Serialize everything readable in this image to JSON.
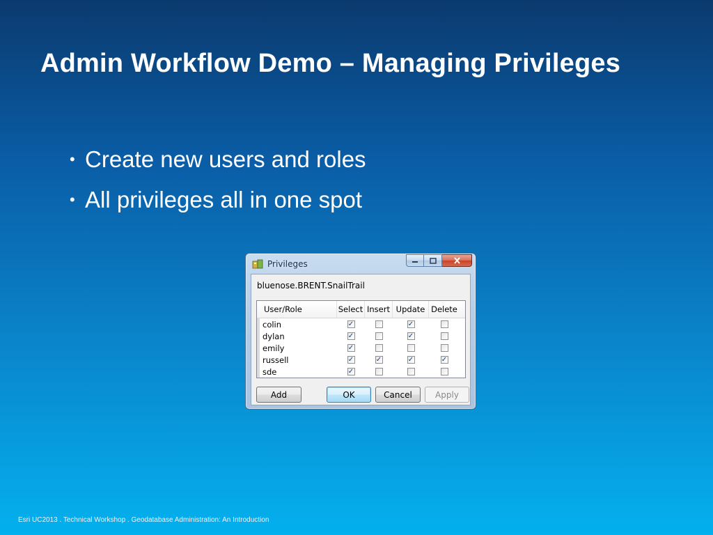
{
  "slide": {
    "title": "Admin Workflow Demo – Managing Privileges",
    "bullets": [
      "Create new users and roles",
      "All privileges all in one spot"
    ],
    "footer": "Esri UC2013 . Technical Workshop . Geodatabase Administration: An Introduction"
  },
  "dialog": {
    "title": "Privileges",
    "caption_buttons": {
      "minimize": "minimize-icon",
      "maximize": "maximize-icon",
      "close": "close-icon"
    },
    "object_name": "bluenose.BRENT.SnailTrail",
    "columns": [
      "User/Role",
      "Select",
      "Insert",
      "Update",
      "Delete"
    ],
    "rows": [
      {
        "user": "colin",
        "select": true,
        "insert": false,
        "update": true,
        "delete": false
      },
      {
        "user": "dylan",
        "select": true,
        "insert": false,
        "update": true,
        "delete": false
      },
      {
        "user": "emily",
        "select": true,
        "insert": false,
        "update": false,
        "delete": false
      },
      {
        "user": "russell",
        "select": true,
        "insert": true,
        "update": true,
        "delete": true
      },
      {
        "user": "sde",
        "select": true,
        "insert": false,
        "update": false,
        "delete": false
      }
    ],
    "buttons": {
      "add": "Add",
      "ok": "OK",
      "cancel": "Cancel",
      "apply": "Apply"
    }
  },
  "colors": {
    "background_top": "#0b3a6e",
    "background_bottom": "#04b0ee",
    "text": "#ffffff"
  }
}
